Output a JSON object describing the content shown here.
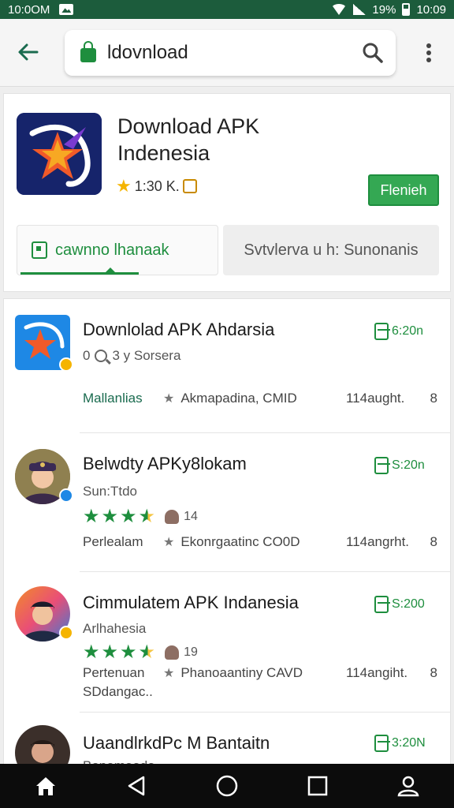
{
  "status_bar": {
    "time_left": "10:0OM",
    "battery": "19%",
    "time_right": "10:09"
  },
  "search": {
    "value": "ldovnload"
  },
  "app": {
    "title": "Download APK Indenesia",
    "rating_text": "1:30 K.",
    "install_label": "Flenieh",
    "tabs": [
      {
        "label": "cawnno lhanaak"
      },
      {
        "label": "Svtvlerva u h: Sunonanis"
      }
    ],
    "accent": "#1e8e3e",
    "icon_bg": "#16246b"
  },
  "list": [
    {
      "title": "Downlolad APK Ahdarsia",
      "sub_prefix": "0",
      "sub": "3 y Sorsera",
      "price": "6:20n",
      "meta": [
        "Mallanlias",
        "Akmapadina, CMID",
        "114aught.",
        "8"
      ]
    },
    {
      "title": "Belwdty APKy8lokam",
      "sub": "Sun:Ttdo",
      "rating": "14",
      "price": "S:20n",
      "meta": [
        "Perlealam",
        "Ekonrgaatinc CO0D",
        "114angrht.",
        "8"
      ]
    },
    {
      "title": "Cimmulatem APK Indanesia",
      "sub": "Arlhahesia",
      "rating": "19",
      "price": "S:200",
      "meta": [
        "Pertenuan",
        "Phanoaantiny CAVD",
        "114angiht.",
        "8"
      ],
      "extra": "SDdangac.."
    },
    {
      "title": "UaandlrkdPc M Bantaitn",
      "sub": "Bonomaada",
      "price": "3:20N"
    }
  ]
}
